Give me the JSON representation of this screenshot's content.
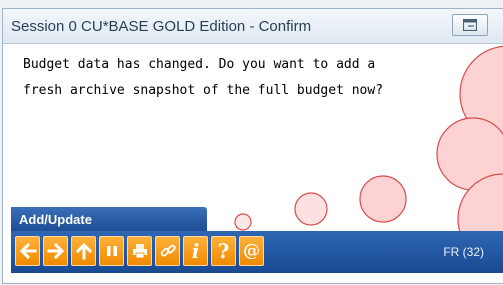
{
  "window": {
    "title": "Session 0 CU*BASE GOLD Edition - Confirm",
    "title_button_icon": "window-toggle-icon"
  },
  "message": {
    "line1": "Budget data has changed. Do you want to add a",
    "line2": "fresh archive snapshot of the full budget now?"
  },
  "mode_label": "Add/Update",
  "toolbar": {
    "buttons": [
      {
        "icon": "arrow-left-icon"
      },
      {
        "icon": "arrow-right-icon"
      },
      {
        "icon": "arrow-up-icon"
      },
      {
        "icon": "pause-icon"
      },
      {
        "icon": "printer-icon"
      },
      {
        "icon": "link-icon"
      },
      {
        "icon": "info-icon",
        "glyph": "i"
      },
      {
        "icon": "help-icon",
        "glyph": "?"
      },
      {
        "icon": "at-icon",
        "glyph": "@"
      }
    ],
    "status": "FR (32)"
  },
  "colors": {
    "accent_blue": "#1d4d96",
    "button_orange": "#f08a00",
    "bubble_fill": "#fcd2d2",
    "bubble_stroke": "#d94c4c"
  }
}
